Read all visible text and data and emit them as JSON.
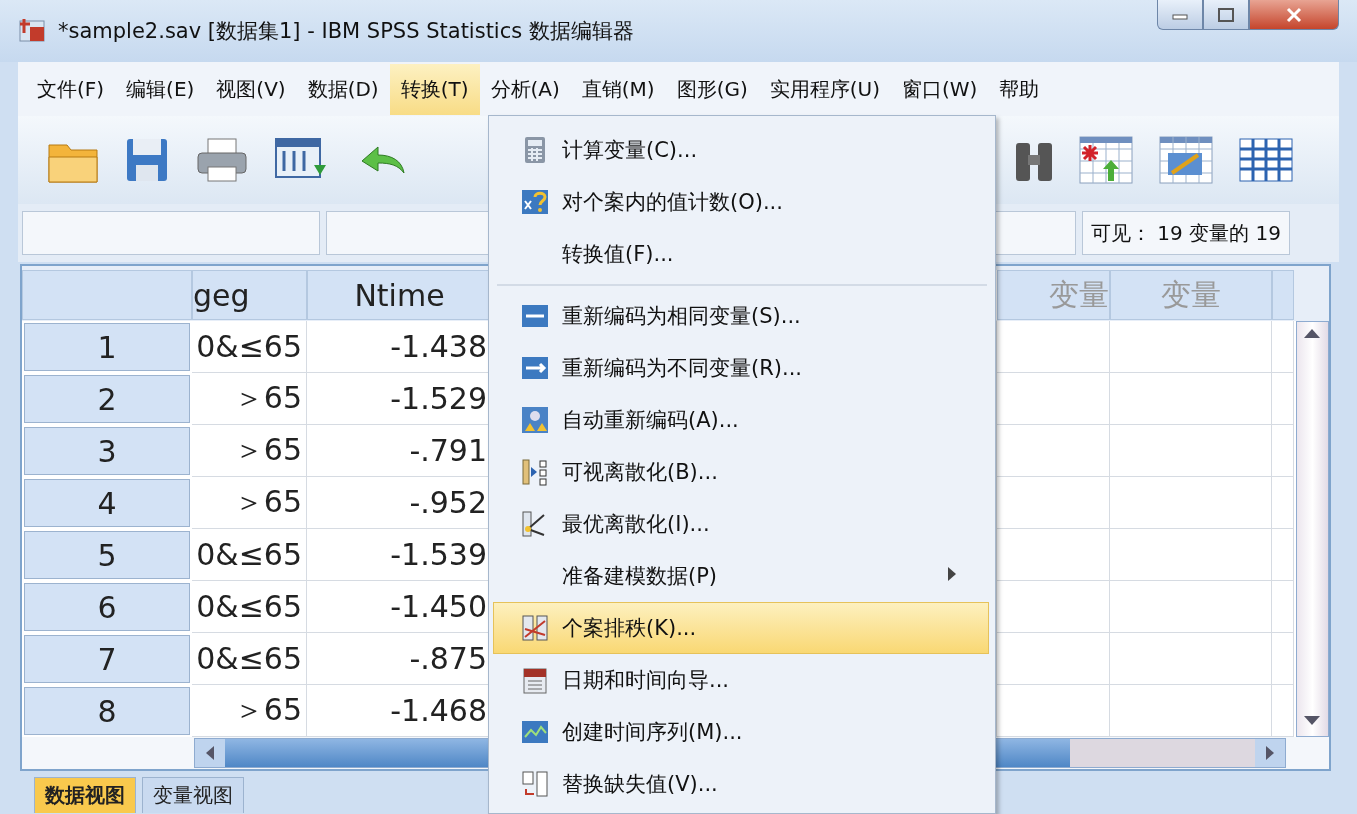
{
  "window": {
    "title": "*sample2.sav [数据集1] - IBM SPSS Statistics 数据编辑器"
  },
  "menubar": [
    {
      "label": "文件(F)",
      "selected": false
    },
    {
      "label": "编辑(E)",
      "selected": false
    },
    {
      "label": "视图(V)",
      "selected": false
    },
    {
      "label": "数据(D)",
      "selected": false
    },
    {
      "label": "转换(T)",
      "selected": true
    },
    {
      "label": "分析(A)",
      "selected": false
    },
    {
      "label": "直销(M)",
      "selected": false
    },
    {
      "label": "图形(G)",
      "selected": false
    },
    {
      "label": "实用程序(U)",
      "selected": false
    },
    {
      "label": "窗口(W)",
      "selected": false
    },
    {
      "label": "帮助",
      "selected": false
    }
  ],
  "cell_editor": {
    "status": "可见： 19 变量的 19"
  },
  "grid": {
    "columns": [
      "geg",
      "Ntime",
      "变量",
      "变量"
    ],
    "rows": [
      {
        "number": "1",
        "cells": [
          "0&≤65",
          "-1.438"
        ]
      },
      {
        "number": "2",
        "cells": [
          "＞65",
          "-1.529"
        ]
      },
      {
        "number": "3",
        "cells": [
          "＞65",
          "-.791"
        ]
      },
      {
        "number": "4",
        "cells": [
          "＞65",
          "-.952"
        ]
      },
      {
        "number": "5",
        "cells": [
          "0&≤65",
          "-1.539"
        ]
      },
      {
        "number": "6",
        "cells": [
          "0&≤65",
          "-1.450"
        ]
      },
      {
        "number": "7",
        "cells": [
          "0&≤65",
          "-.875"
        ]
      },
      {
        "number": "8",
        "cells": [
          "＞65",
          "-1.468"
        ]
      }
    ]
  },
  "bottom_tabs": [
    {
      "label": "数据视图",
      "selected": true
    },
    {
      "label": "变量视图",
      "selected": false
    }
  ],
  "menu": {
    "items": [
      {
        "kind": "item",
        "label": "计算变量(C)...",
        "selected": false,
        "submenu": false
      },
      {
        "kind": "item",
        "label": "对个案内的值计数(O)...",
        "selected": false,
        "submenu": false
      },
      {
        "kind": "item",
        "label": "转换值(F)...",
        "selected": false,
        "submenu": false
      },
      {
        "kind": "separator"
      },
      {
        "kind": "item",
        "label": "重新编码为相同变量(S)...",
        "selected": false,
        "submenu": false
      },
      {
        "kind": "item",
        "label": "重新编码为不同变量(R)...",
        "selected": false,
        "submenu": false
      },
      {
        "kind": "item",
        "label": "自动重新编码(A)...",
        "selected": false,
        "submenu": false
      },
      {
        "kind": "item",
        "label": "可视离散化(B)...",
        "selected": false,
        "submenu": false
      },
      {
        "kind": "item",
        "label": "最优离散化(I)...",
        "selected": false,
        "submenu": false
      },
      {
        "kind": "item",
        "label": "准备建模数据(P)",
        "selected": false,
        "submenu": true
      },
      {
        "kind": "item",
        "label": "个案排秩(K)...",
        "selected": true,
        "submenu": false
      },
      {
        "kind": "item",
        "label": "日期和时间向导...",
        "selected": false,
        "submenu": false
      },
      {
        "kind": "item",
        "label": "创建时间序列(M)...",
        "selected": false,
        "submenu": false
      },
      {
        "kind": "item",
        "label": "替换缺失值(V)...",
        "selected": false,
        "submenu": false
      }
    ]
  }
}
